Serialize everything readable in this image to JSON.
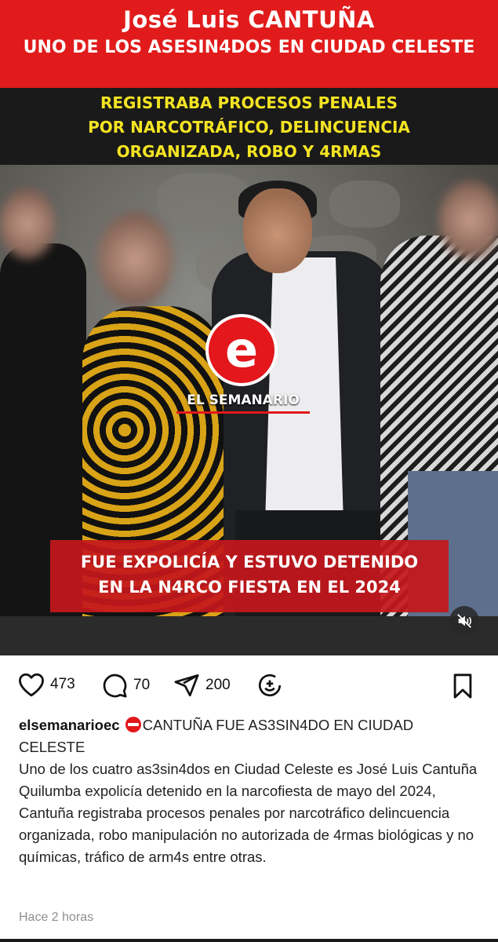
{
  "media": {
    "title_line1": "José Luis CANTUÑA",
    "title_line2": "UNO DE LOS ASESIN4DOS EN CIUDAD CELESTE",
    "subtitle_lines": [
      "REGISTRABA PROCESOS PENALES",
      "POR NARCOTRÁFICO, DELINCUENCIA",
      "ORGANIZADA, ROBO Y 4RMAS"
    ],
    "logo_letter": "e",
    "logo_text": "EL SEMANARIO",
    "caption_lines": [
      "FUE EXPOLICÍA Y ESTUVO DETENIDO",
      "EN LA N4RCO FIESTA EN EL 2024"
    ],
    "mute_icon": "muted-speaker-icon",
    "colors": {
      "banner_red": "#e11b1b",
      "subtitle_yellow": "#f4e423",
      "logo_red": "#e3171c"
    }
  },
  "actions": {
    "likes": "473",
    "comments": "70",
    "shares": "200",
    "icons": [
      "heart-icon",
      "comment-icon",
      "share-icon",
      "add-reaction-icon",
      "bookmark-icon"
    ]
  },
  "post": {
    "username": "elsemanarioec",
    "headline": "CANTUÑA FUE AS3SIN4DO EN CIUDAD CELESTE",
    "body": "Uno de los cuatro as3sin4dos en Ciudad Celeste es José Luis Cantuña Quilumba expolicía detenido en la narcofiesta de mayo del 2024, Cantuña registraba procesos penales por narcotráfico delincuencia organizada, robo manipulación no autorizada de 4rmas biológicas y no químicas, tráfico de arm4s entre otras.",
    "timestamp": "Hace 2 horas"
  }
}
